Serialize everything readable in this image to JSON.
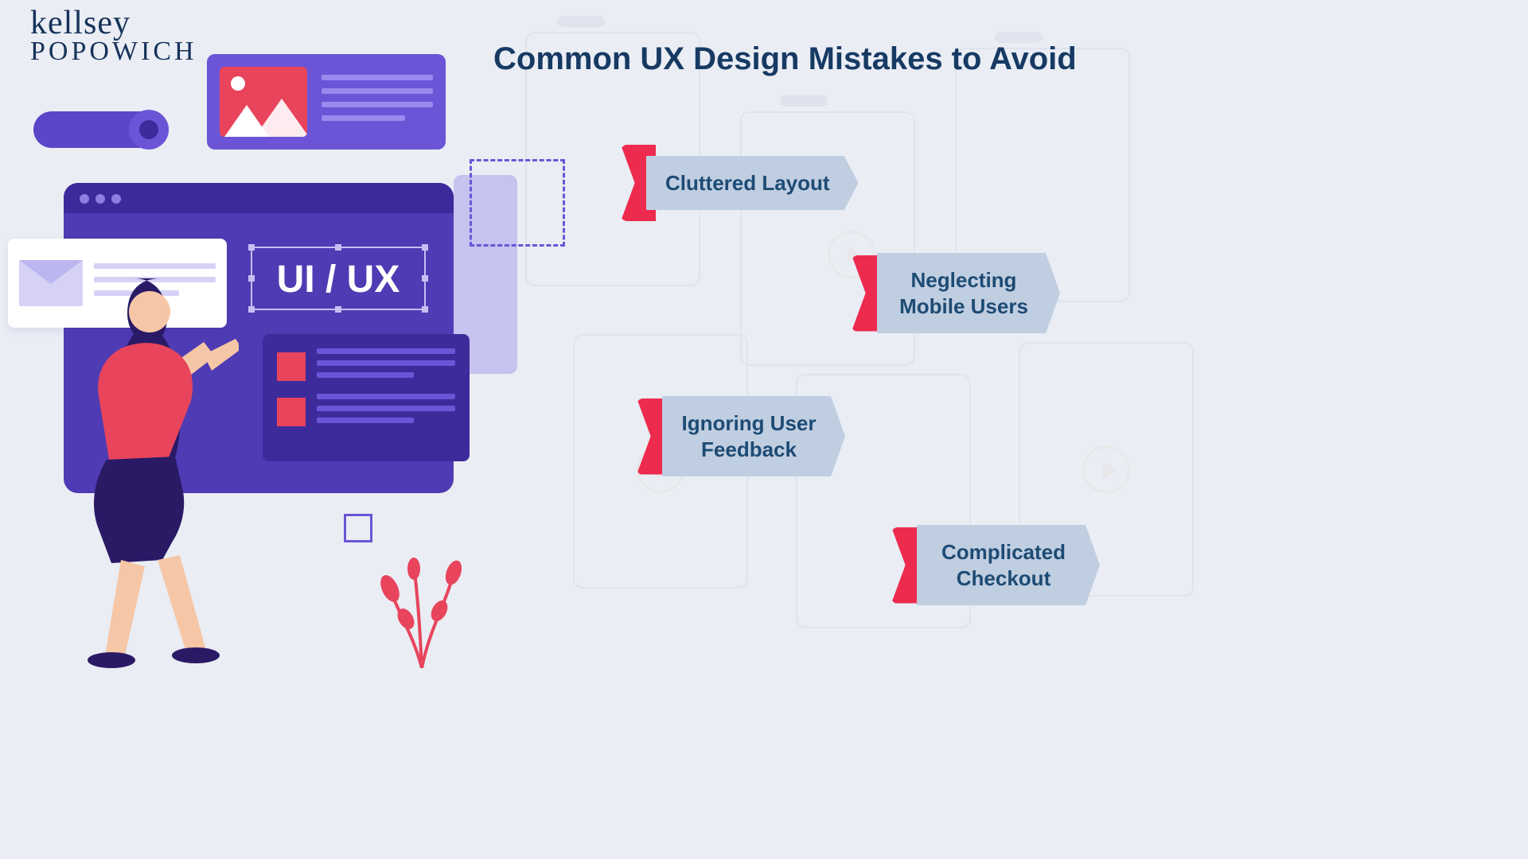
{
  "logo": {
    "script": "kellsey",
    "serif": "POPOWICH"
  },
  "title": "Common UX Design Mistakes to Avoid",
  "illustration": {
    "ui_label": "UI / UX"
  },
  "mistakes": [
    "Cluttered Layout",
    "Neglecting\nMobile Users",
    "Ignoring User\nFeedback",
    "Complicated\nCheckout"
  ],
  "colors": {
    "title": "#163a63",
    "bubble_bg": "#c0cee1",
    "bubble_text": "#1d4b74",
    "notch": "#ed2b4f",
    "purple_dark": "#3d2b9c",
    "purple": "#6b55d6"
  }
}
